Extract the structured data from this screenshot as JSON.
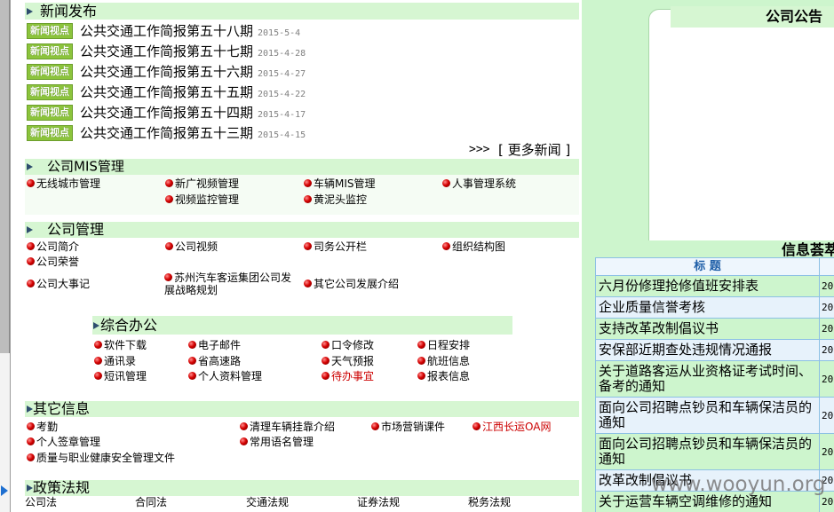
{
  "news": {
    "title": "新闻发布",
    "badge": "新闻视点",
    "items": [
      {
        "title": "公共交通工作简报第五十八期",
        "date": "2015-5-4"
      },
      {
        "title": "公共交通工作简报第五十七期",
        "date": "2015-4-28"
      },
      {
        "title": "公共交通工作简报第五十六期",
        "date": "2015-4-27"
      },
      {
        "title": "公共交通工作简报第五十五期",
        "date": "2015-4-22"
      },
      {
        "title": "公共交通工作简报第五十四期",
        "date": "2015-4-17"
      },
      {
        "title": "公共交通工作简报第五十三期",
        "date": "2015-4-15"
      }
    ],
    "more_arrows": ">>>",
    "more_label": "[ 更多新闻 ]"
  },
  "mis": {
    "title": "公司MIS管理",
    "items": [
      "无线城市管理",
      "新广视频管理",
      "车辆MIS管理",
      "人事管理系统",
      "视频监控管理",
      "黄泥头监控"
    ]
  },
  "company": {
    "title": "公司管理",
    "items": [
      "公司简介",
      "公司视频",
      "司务公开栏",
      "组织结构图",
      "公司荣誉",
      "公司大事记",
      "苏州汽车客运集团公司发展战略规划",
      "其它公司发展介绍"
    ]
  },
  "office": {
    "title": "综合办公",
    "items": [
      "软件下载",
      "电子邮件",
      "口令修改",
      "日程安排",
      "通讯录",
      "省高速路",
      "天气预报",
      "航班信息",
      "短讯管理",
      "个人资料管理",
      "待办事宜",
      "报表信息"
    ]
  },
  "other": {
    "title": "其它信息",
    "items": [
      "考勤",
      "清理车辆挂靠介绍",
      "市场营销课件",
      "江西长运OA网",
      "个人签章管理",
      "常用语名管理",
      "质量与职业健康安全管理文件"
    ]
  },
  "policy": {
    "title": "政策法规",
    "items": [
      "公司法",
      "合同法",
      "交通法规",
      "证券法规",
      "税务法规"
    ]
  },
  "announcement": {
    "title": "公司公告"
  },
  "info": {
    "title": "信息荟萃",
    "column_title": "标 题",
    "rows": [
      {
        "title": "六月份修理抢修值班安排表",
        "date": "201"
      },
      {
        "title": "企业质量信誉考核",
        "date": "201"
      },
      {
        "title": "支持改革改制倡议书",
        "date": "201"
      },
      {
        "title": "安保部近期查处违规情况通报",
        "date": "201"
      },
      {
        "title": "关于道路客运从业资格证考试时间、备考的通知",
        "date": "201"
      },
      {
        "title": "面向公司招聘点钞员和车辆保洁员的通知",
        "date": "201"
      },
      {
        "title": "面向公司招聘点钞员和车辆保洁员的通知",
        "date": "201"
      },
      {
        "title": "改革改制倡议书",
        "date": "201"
      },
      {
        "title": "关于运营车辆空调维修的通知",
        "date": "201"
      }
    ]
  },
  "watermark": "www.wooyun.org",
  "icons": {
    "section_header": "arrow-right-icon",
    "link_bullet": "red-ball-icon",
    "frame_toggle": "arrow-right-icon"
  },
  "colors": {
    "header_bg": "#d6f6d2",
    "panel_bg": "#cdf5cd",
    "badge_bg": "#8cc43c",
    "highlight_text": "#cc0000",
    "table_border": "#8cc0e4",
    "table_alt_row": "#e7f2fb",
    "table_header_text": "#1f5fa8",
    "table_header_bg": "#eef6fd",
    "bullet": "#d40000",
    "frame_arrow": "#1e6fd0",
    "section_arrow": "#2e4d6e"
  }
}
